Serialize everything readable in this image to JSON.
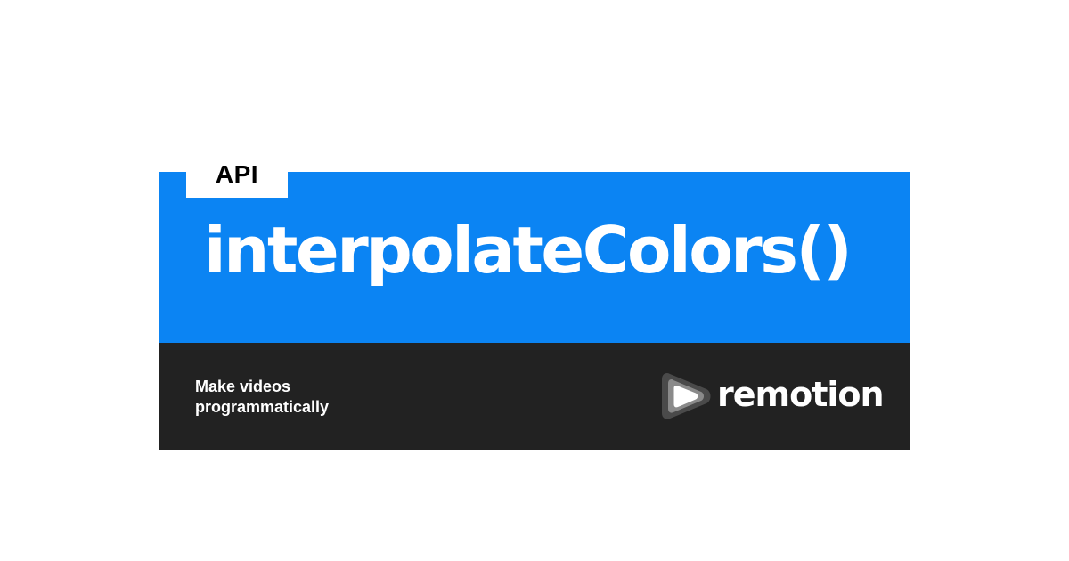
{
  "badge": {
    "label": "API"
  },
  "title": "interpolateColors()",
  "footer": {
    "tagline_line1": "Make videos",
    "tagline_line2": "programmatically",
    "brand_name": "remotion",
    "brand_icon": "remotion-play-logo-icon"
  },
  "colors": {
    "background": "#ffffff",
    "accent_blue": "#0b84f3",
    "footer_dark": "#222222",
    "text_light": "#ffffff",
    "text_dark": "#000000"
  }
}
